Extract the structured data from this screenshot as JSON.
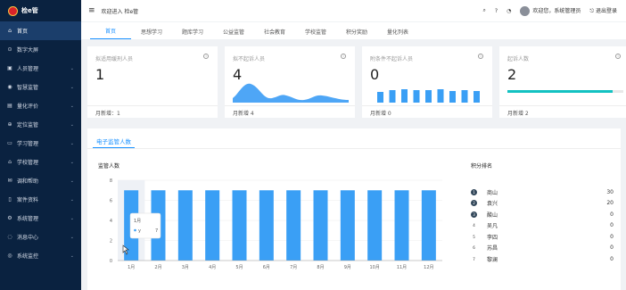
{
  "sidebar": {
    "logo": "检e管",
    "items": [
      {
        "label": "首页",
        "icon": "home-icon",
        "glyph": "⌂"
      },
      {
        "label": "数字大屏",
        "icon": "monitor-icon",
        "glyph": "⊙"
      },
      {
        "label": "人员管理",
        "icon": "user-icon",
        "glyph": "▣"
      },
      {
        "label": "智慧监管",
        "icon": "eye-icon",
        "glyph": "◉"
      },
      {
        "label": "量化评价",
        "icon": "chart-icon",
        "glyph": "▤"
      },
      {
        "label": "定位监管",
        "icon": "location-icon",
        "glyph": "⊕"
      },
      {
        "label": "学习管理",
        "icon": "book-icon",
        "glyph": "▭"
      },
      {
        "label": "学校管理",
        "icon": "school-icon",
        "glyph": "⌂"
      },
      {
        "label": "调和帮助",
        "icon": "help-icon",
        "glyph": "✉"
      },
      {
        "label": "案件资料",
        "icon": "file-icon",
        "glyph": "▯"
      },
      {
        "label": "系统管理",
        "icon": "gear-icon",
        "glyph": "⚙"
      },
      {
        "label": "消息中心",
        "icon": "message-icon",
        "glyph": "◌"
      },
      {
        "label": "系统监控",
        "icon": "monitor-icon",
        "glyph": "◎"
      }
    ]
  },
  "header": {
    "welcome": "欢迎进入 检e管",
    "user": "欢迎您，系统管理员",
    "logout": "退出登录"
  },
  "tabs": [
    "首页",
    "思想学习",
    "题库学习",
    "公益监管",
    "社会教育",
    "学校监管",
    "积分奖励",
    "量化列表"
  ],
  "cards": [
    {
      "title": "拟适用缓刑人员",
      "value": "1",
      "foot": "月新增：1"
    },
    {
      "title": "拟不起诉人员",
      "value": "4",
      "foot": "月新增 4"
    },
    {
      "title": "附条件不起诉人员",
      "value": "0",
      "foot": "月新增 0"
    },
    {
      "title": "起诉人数",
      "value": "2",
      "foot": "月新增 2"
    }
  ],
  "panel": {
    "tab": "电子监管人数",
    "chart_title": "监管人数",
    "tooltip_title": "1月",
    "tooltip_series": "y",
    "tooltip_value": "7"
  },
  "chart_data": {
    "type": "bar",
    "categories": [
      "1月",
      "2月",
      "3月",
      "4月",
      "5月",
      "6月",
      "7月",
      "8月",
      "9月",
      "10月",
      "11月",
      "12月"
    ],
    "values": [
      7,
      7,
      7,
      7,
      7,
      7,
      7,
      7,
      7,
      7,
      7,
      7
    ],
    "ylim": [
      0,
      8
    ],
    "yticks": [
      0,
      2,
      4,
      6,
      8
    ],
    "color": "#3a9ff5"
  },
  "ranking": {
    "title": "积分排名",
    "rows": [
      {
        "rank": "1",
        "name": "商山",
        "score": "30"
      },
      {
        "rank": "2",
        "name": "袁兴",
        "score": "20"
      },
      {
        "rank": "3",
        "name": "酸山",
        "score": "0"
      },
      {
        "rank": "4",
        "name": "吴凡",
        "score": "0"
      },
      {
        "rank": "5",
        "name": "李四",
        "score": "0"
      },
      {
        "rank": "6",
        "name": "苏昌",
        "score": "0"
      },
      {
        "rank": "7",
        "name": "黎澜",
        "score": "0"
      }
    ]
  }
}
